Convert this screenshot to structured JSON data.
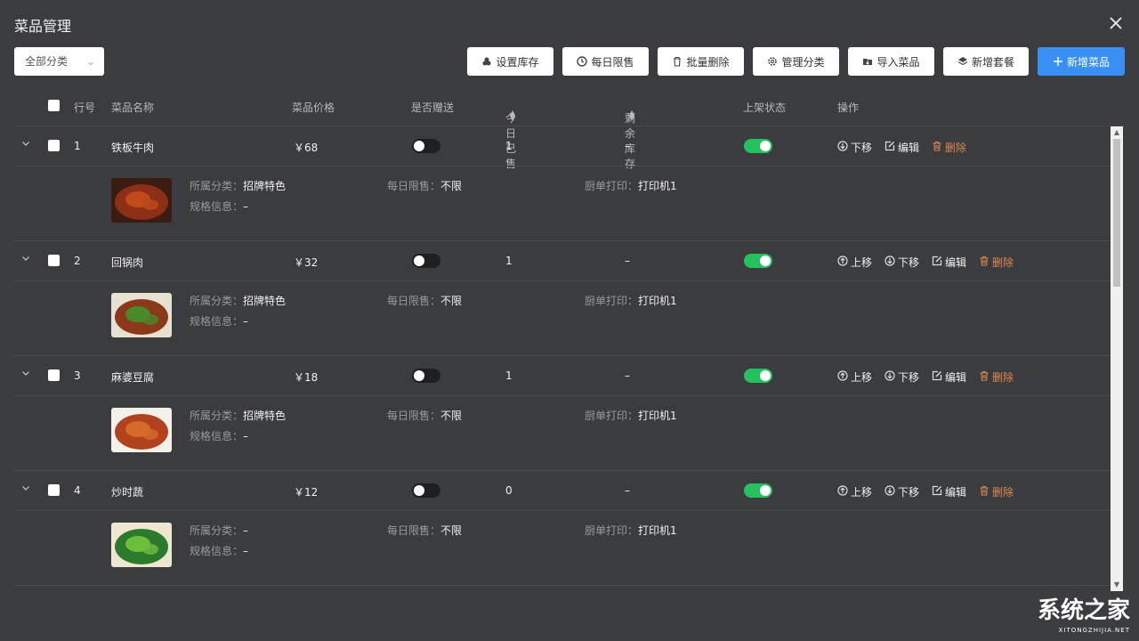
{
  "window": {
    "title": "菜品管理"
  },
  "filter": {
    "category_select": "全部分类"
  },
  "toolbar": {
    "set_stock": "设置库存",
    "daily_limit": "每日限售",
    "batch_delete": "批量删除",
    "manage_category": "管理分类",
    "import_dish": "导入菜品",
    "add_combo": "新增套餐",
    "add_dish": "新增菜品",
    "add_dish_color": "#3a8ff5"
  },
  "table": {
    "headers": {
      "row_no": "行号",
      "name": "菜品名称",
      "price": "菜品价格",
      "gift": "是否赠送",
      "sold_today": "今日已售",
      "stock": "剩余库存",
      "status": "上架状态",
      "ops": "操作"
    },
    "labels": {
      "category": "所属分类：",
      "spec": "规格信息：",
      "daily_limit": "每日限售：",
      "kitchen_print": "厨单打印："
    },
    "actions": {
      "up": "上移",
      "down": "下移",
      "edit": "编辑",
      "delete": "删除"
    },
    "rows": [
      {
        "no": "1",
        "name": "铁板牛肉",
        "price": "￥68",
        "gift": false,
        "sold": "1",
        "stock": "–",
        "on_shelf": true,
        "category": "招牌特色",
        "spec": "–",
        "limit": "不限",
        "printer": "打印机1",
        "image_icon": "beef-dish-icon"
      },
      {
        "no": "2",
        "name": "回锅肉",
        "price": "￥32",
        "gift": false,
        "sold": "1",
        "stock": "–",
        "on_shelf": true,
        "category": "招牌特色",
        "spec": "–",
        "limit": "不限",
        "printer": "打印机1",
        "image_icon": "pork-dish-icon"
      },
      {
        "no": "3",
        "name": "麻婆豆腐",
        "price": "￥18",
        "gift": false,
        "sold": "1",
        "stock": "–",
        "on_shelf": true,
        "category": "招牌特色",
        "spec": "–",
        "limit": "不限",
        "printer": "打印机1",
        "image_icon": "tofu-dish-icon"
      },
      {
        "no": "4",
        "name": "炒时蔬",
        "price": "￥12",
        "gift": false,
        "sold": "0",
        "stock": "–",
        "on_shelf": true,
        "category": "–",
        "spec": "–",
        "limit": "不限",
        "printer": "打印机1",
        "image_icon": "vegetable-dish-icon"
      }
    ]
  },
  "watermark": {
    "brand": "系统之家",
    "url": "XITONGZHIJIA.NET"
  }
}
